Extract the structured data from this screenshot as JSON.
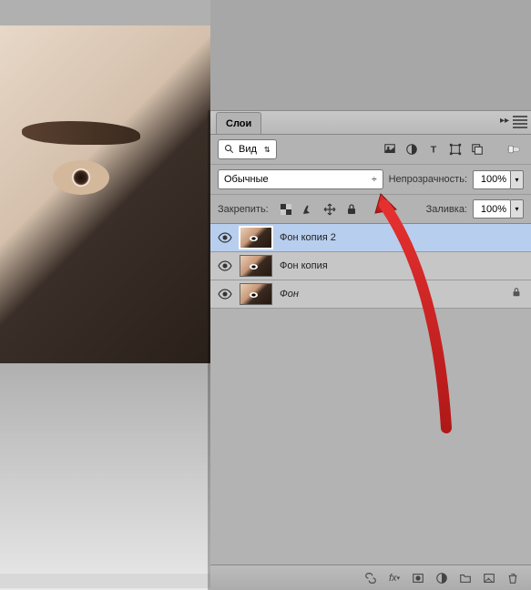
{
  "panel": {
    "title": "Слои",
    "filter_label": "Вид",
    "blend_mode": "Обычные",
    "opacity_label": "Непрозрачность:",
    "opacity_value": "100%",
    "lock_label": "Закрепить:",
    "fill_label": "Заливка:",
    "fill_value": "100%"
  },
  "layers": [
    {
      "name": "Фон копия 2",
      "italic": false,
      "locked": false,
      "selected": true
    },
    {
      "name": "Фон копия",
      "italic": false,
      "locked": false,
      "selected": false
    },
    {
      "name": "Фон",
      "italic": true,
      "locked": true,
      "selected": false
    }
  ]
}
